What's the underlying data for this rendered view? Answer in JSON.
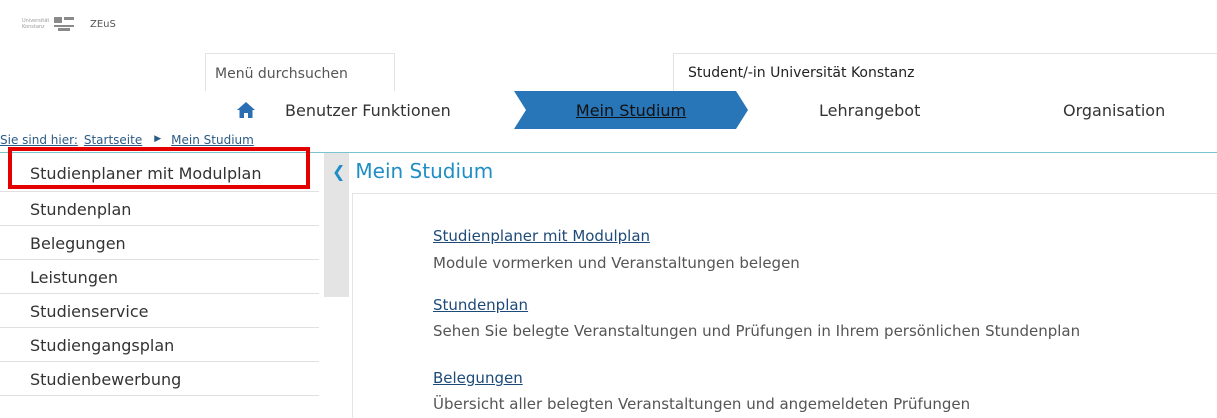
{
  "header": {
    "logo_text": "Universität Konstanz",
    "app_name": "ZEuS",
    "search_placeholder": "Menü durchsuchen",
    "user_role": "Student/-in Universität Konstanz"
  },
  "nav": {
    "items": [
      {
        "label": "Benutzer Funktionen"
      },
      {
        "label": "Mein Studium",
        "active": true
      },
      {
        "label": "Lehrangebot"
      },
      {
        "label": "Organisation"
      }
    ]
  },
  "breadcrumb": {
    "prefix": "Sie sind hier:",
    "items": [
      "Startseite",
      "Mein Studium"
    ]
  },
  "sidebar": {
    "items": [
      {
        "label": "Studienplaner mit Modulplan",
        "highlighted": true
      },
      {
        "label": "Stundenplan"
      },
      {
        "label": "Belegungen"
      },
      {
        "label": "Leistungen"
      },
      {
        "label": "Studienservice"
      },
      {
        "label": "Studiengangsplan"
      },
      {
        "label": "Studienbewerbung"
      }
    ]
  },
  "main": {
    "title": "Mein Studium",
    "entries": [
      {
        "link": "Studienplaner mit Modulplan",
        "description": "Module vormerken und Veranstaltungen belegen"
      },
      {
        "link": "Stundenplan",
        "description": "Sehen Sie belegte Veranstaltungen und Prüfungen in Ihrem persönlichen Stundenplan"
      },
      {
        "link": "Belegungen",
        "description": "Übersicht aller belegten Veranstaltungen und angemeldeten Prüfungen"
      }
    ]
  },
  "colors": {
    "accent": "#1f8ec7",
    "nav_active": "#2876b8",
    "highlight": "#e50000"
  }
}
